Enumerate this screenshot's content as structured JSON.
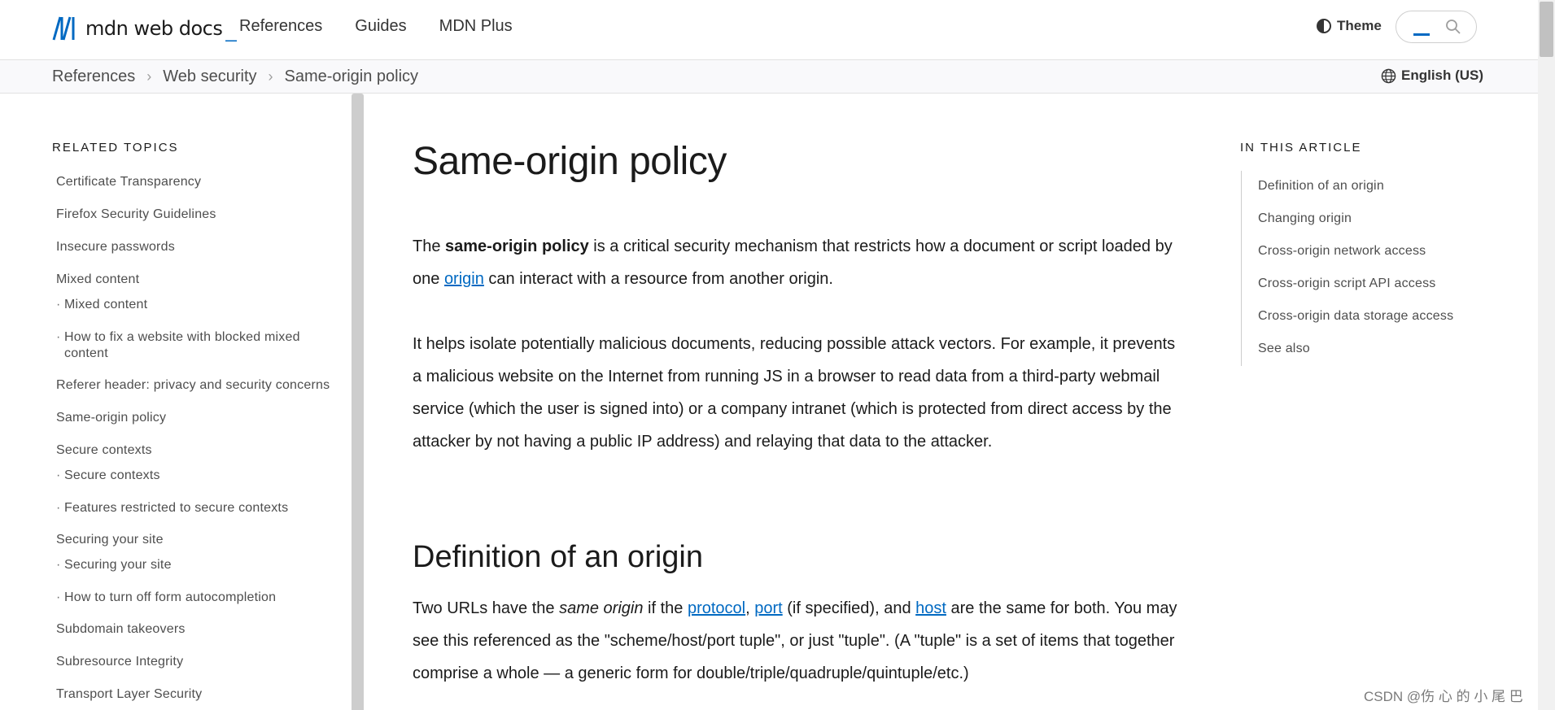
{
  "header": {
    "logo_text": "mdn web docs",
    "logo_suffix": "_",
    "nav": [
      "References",
      "Guides",
      "MDN Plus"
    ],
    "theme_label": "Theme"
  },
  "breadcrumb": {
    "items": [
      "References",
      "Web security",
      "Same-origin policy"
    ],
    "separator": "›",
    "language": "English (US)"
  },
  "sidebar": {
    "heading": "RELATED TOPICS",
    "items": [
      "Certificate Transparency",
      "Firefox Security Guidelines",
      "Insecure passwords",
      "Mixed content",
      "Mixed content",
      "How to fix a website with blocked mixed content",
      "Referer header: privacy and security concerns",
      "Same-origin policy",
      "Secure contexts",
      "Secure contexts",
      "Features restricted to secure contexts",
      "Securing your site",
      "Securing your site",
      "How to turn off form autocompletion",
      "Subdomain takeovers",
      "Subresource Integrity",
      "Transport Layer Security"
    ],
    "bullet": "·"
  },
  "article": {
    "title": "Same-origin policy",
    "p1": {
      "a": "The ",
      "strong": "same-origin policy",
      "b": " is a critical security mechanism that restricts how a document or script loaded by one ",
      "link": "origin",
      "c": " can interact with a resource from another origin."
    },
    "p2": "It helps isolate potentially malicious documents, reducing possible attack vectors. For example, it prevents a malicious website on the Internet from running JS in a browser to read data from a third-party webmail service (which the user is signed into) or a company intranet (which is protected from direct access by the attacker by not having a public IP address) and relaying that data to the attacker.",
    "h2": "Definition of an origin",
    "p3": {
      "a": "Two URLs have the ",
      "em": "same origin",
      "b": " if the ",
      "link1": "protocol",
      "comma": ", ",
      "link2": "port",
      "c": " (if specified), and ",
      "link3": "host",
      "d": " are the same for both. You may see this referenced as the \"scheme/host/port tuple\", or just \"tuple\". (A \"tuple\" is a set of items that together comprise a whole — a generic form for double/triple/quadruple/quintuple/etc.)"
    }
  },
  "toc": {
    "heading": "IN THIS ARTICLE",
    "items": [
      "Definition of an origin",
      "Changing origin",
      "Cross-origin network access",
      "Cross-origin script API access",
      "Cross-origin data storage access",
      "See also"
    ]
  },
  "watermark": "CSDN @伤 心 的 小 尾 巴",
  "colors": {
    "accent": "#0069c2",
    "text": "#1b1b1b",
    "muted": "#4e4e4e"
  }
}
